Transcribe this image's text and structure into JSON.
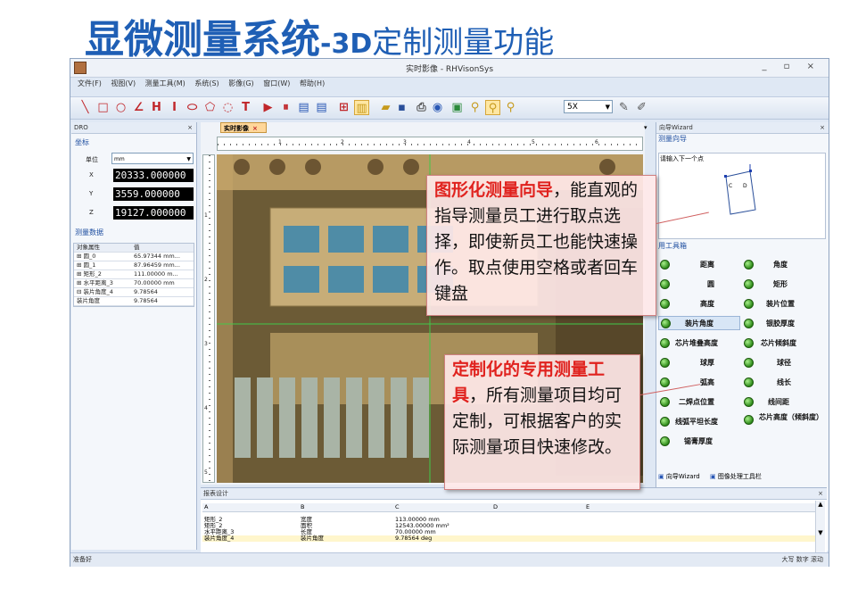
{
  "slide_title": {
    "part1": "显微测量系统",
    "part2": "-3D",
    "part3": "定制测量功能"
  },
  "window": {
    "title": "实时影像 - RHVisonSys",
    "controls": "_ ▫ ×"
  },
  "menu": [
    "文件(F)",
    "视图(V)",
    "测量工具(M)",
    "系统(S)",
    "影像(G)",
    "窗口(W)",
    "帮助(H)"
  ],
  "toolbar": {
    "zoom_value": "5X"
  },
  "left_panel": {
    "header": "DRO",
    "coord_section": "坐标",
    "unit_label": "单位",
    "unit_value": "mm",
    "coords": [
      {
        "axis": "X",
        "value": "20333.000000"
      },
      {
        "axis": "Y",
        "value": "3559.000000"
      },
      {
        "axis": "Z",
        "value": "19127.000000"
      }
    ],
    "data_section": "测量数据",
    "table_headers": [
      "对象属性",
      "值"
    ],
    "table_rows": [
      {
        "name": "⊞ 圆_0",
        "value": "65.97344 mm..."
      },
      {
        "name": "⊞ 圆_1",
        "value": "87.96459 mm..."
      },
      {
        "name": "⊞ 矩形_2",
        "value": "111.00000 m..."
      },
      {
        "name": "⊞ 水平距离_3",
        "value": "70.00000 mm"
      },
      {
        "name": "⊟ 装片角度_4",
        "value": "9.78564"
      },
      {
        "name": "    装片角度",
        "value": "9.78564"
      }
    ]
  },
  "image_panel": {
    "tab": "实时影像",
    "ruler_marks": [
      "1",
      "2",
      "3",
      "4",
      "5",
      "6"
    ],
    "vruler_marks": [
      "1",
      "2",
      "3",
      "4",
      "5"
    ]
  },
  "right_panel": {
    "header": "向导Wizard",
    "guide_title": "测量向导",
    "guide_prompt": "请输入下一个点",
    "toolbox_title": "用工具箱",
    "tools": [
      [
        "距离",
        "角度"
      ],
      [
        "圆",
        "矩形"
      ],
      [
        "高度",
        "装片位置"
      ],
      [
        "装片角度",
        "银胶厚度"
      ],
      [
        "芯片堆叠高度",
        "芯片倾斜度"
      ],
      [
        "球厚",
        "球径"
      ],
      [
        "弧高",
        "线长"
      ],
      [
        "二焊点位置",
        "线间距"
      ],
      [
        "线弧平坦长度",
        "芯片高度（倾斜度）"
      ],
      [
        "锡膏厚度",
        ""
      ]
    ],
    "tabs": [
      "向导Wizard",
      "图像处理工具栏"
    ]
  },
  "report": {
    "header": "报表设计",
    "columns": [
      "A",
      "B",
      "C",
      "D",
      "E"
    ],
    "rows": [
      [
        "矩形_2",
        "宽度",
        "113.00000 mm"
      ],
      [
        "矩形_2",
        "面积",
        "12543.00000 mm²"
      ],
      [
        "水平距离_3",
        "长度",
        "70.00000 mm"
      ],
      [
        "装片角度_4",
        "装片角度",
        "9.78564 deg"
      ]
    ]
  },
  "status": {
    "left": "准备好",
    "right": "大写  数字  滚动"
  },
  "callouts": {
    "guide": {
      "highlight": "图形化测量向导",
      "text": "，能直观的指导测量员工进行取点选择，即使新员工也能快速操作。取点使用空格或者回车键盘"
    },
    "custom": {
      "highlight": "定制化的专用测量工具",
      "text": "，所有测量项目均可定制，可根据客户的实际测量项目快速修改。"
    }
  }
}
